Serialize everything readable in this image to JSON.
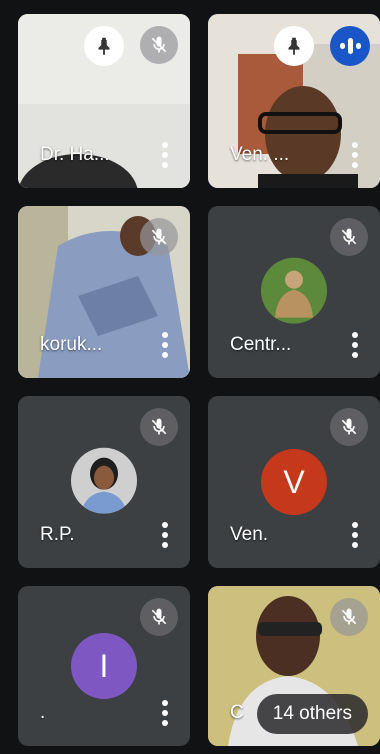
{
  "participants": [
    {
      "name": "Dr. Ha...",
      "pinned": true,
      "muted": true
    },
    {
      "name": "Ven. ...",
      "pinned": true,
      "speaking": true
    },
    {
      "name": "koruk...",
      "muted": true
    },
    {
      "name": "Centr...",
      "muted": true
    },
    {
      "name": "R.P.",
      "muted": true
    },
    {
      "name": "Ven.",
      "muted": true,
      "avatar_letter": "V",
      "avatar_color": "#c5381b"
    },
    {
      "name": ".",
      "muted": true,
      "avatar_letter": "I",
      "avatar_color": "#7e57c2"
    },
    {
      "name": "C",
      "muted": true
    }
  ],
  "others_label": "14 others",
  "icons": {
    "mute": "mic-off-icon",
    "pin": "pin-icon",
    "speaking": "audio-wave-icon",
    "more": "more-vert-icon"
  },
  "colors": {
    "tile_bg": "#3c4043",
    "active_border": "#1a56c8",
    "page_bg": "#111214"
  }
}
